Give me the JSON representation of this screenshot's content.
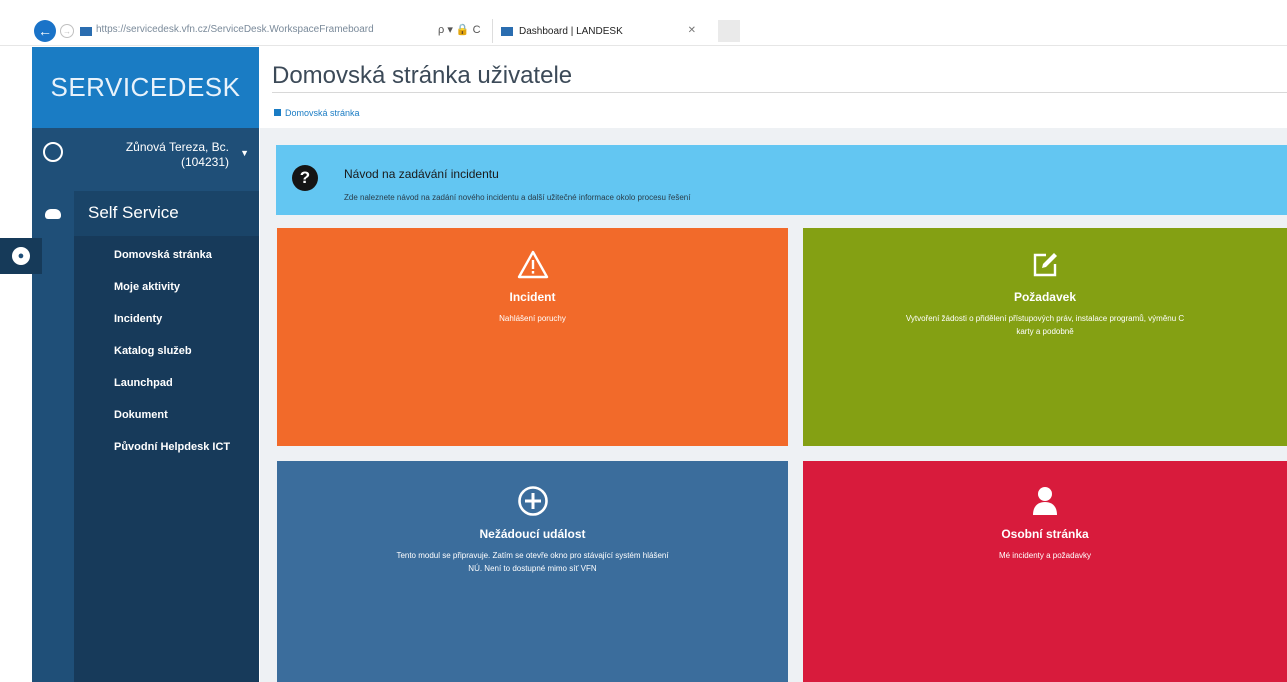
{
  "browser": {
    "url": "https://servicedesk.vfn.cz/ServiceDesk.WorkspaceFrameboard",
    "tab_title": "Dashboard | LANDESK",
    "address_controls": "ρ ▾ 🔒 C"
  },
  "sidebar": {
    "brand": "SERVICEDESK",
    "user_name": "Zůnová Tereza, Bc.",
    "user_id": "(104231)",
    "section": "Self Service",
    "items": [
      {
        "label": "Domovská stránka"
      },
      {
        "label": "Moje aktivity"
      },
      {
        "label": "Incidenty"
      },
      {
        "label": "Katalog služeb"
      },
      {
        "label": "Launchpad"
      },
      {
        "label": "Dokument"
      },
      {
        "label": "Původní Helpdesk ICT"
      }
    ]
  },
  "header": {
    "title": "Domovská stránka uživatele",
    "breadcrumb": "Domovská stránka"
  },
  "alert": {
    "title": "Návod na zadávání incidentu",
    "text": "Zde naleznete návod na zadání nového incidentu a další užitečné informace okolo procesu řešení"
  },
  "tiles": {
    "incident": {
      "title": "Incident",
      "desc": "Nahlášení poruchy",
      "color": "#f26a2a",
      "icon": "warning-icon"
    },
    "request": {
      "title": "Požadavek",
      "desc_line1": "Vytvoření žádosti o přidělení přístupových práv, instalace programů, výměnu C",
      "desc_line2": "karty a podobně",
      "color": "#84a013",
      "icon": "edit-icon"
    },
    "adverse": {
      "title": "Nežádoucí událost",
      "desc_line1": "Tento modul se připravuje. Zatím se otevře okno pro stávající systém hlášení",
      "desc_line2": "NÚ. Není to dostupné mimo síť VFN",
      "color": "#3b6d9c",
      "icon": "plus-circle-icon"
    },
    "personal": {
      "title": "Osobní stránka",
      "desc": "Mé incidenty a požadavky",
      "color": "#d81b3c",
      "icon": "user-icon"
    }
  }
}
